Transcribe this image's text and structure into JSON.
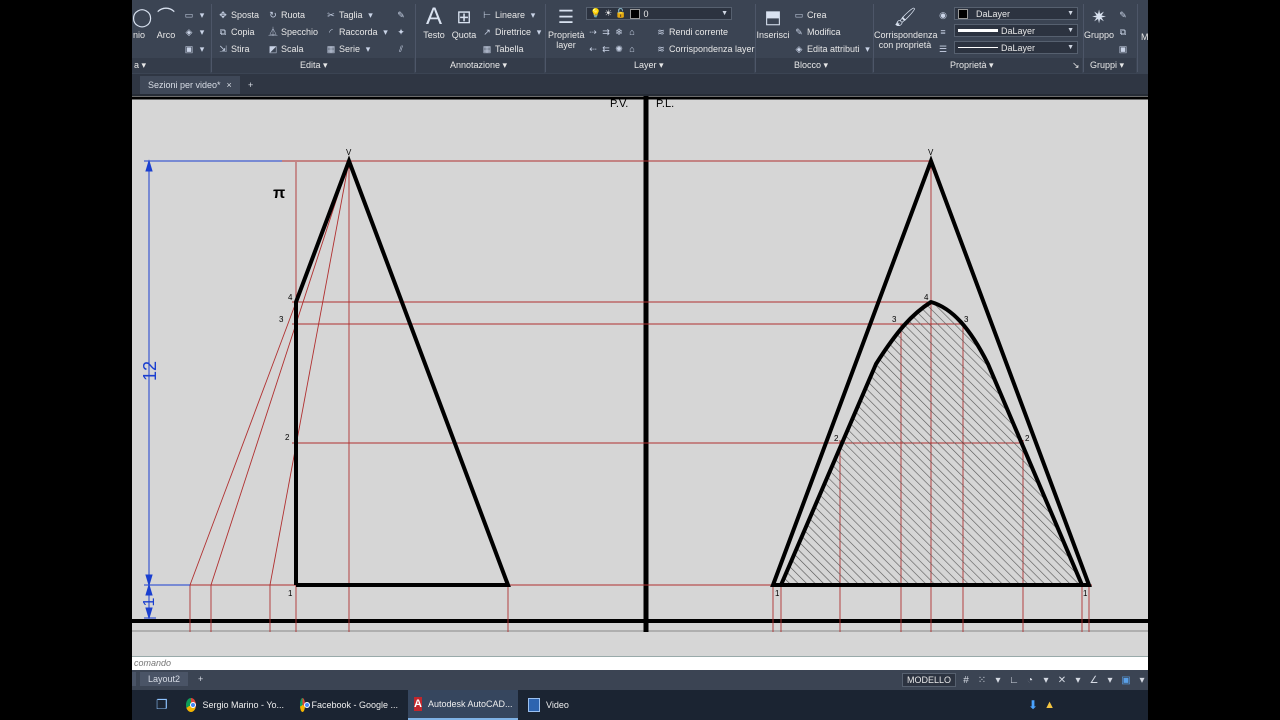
{
  "ribbon": {
    "partial_left_label": "nio",
    "arc_label": "Arco",
    "edit": {
      "title": "Edita",
      "items": [
        "Sposta",
        "Ruota",
        "Taglia",
        "Copia",
        "Specchio",
        "Raccorda",
        "Stira",
        "Scala",
        "Serie"
      ]
    },
    "annotation": {
      "title": "Annotazione",
      "text_label": "Testo",
      "dim_label": "Quota",
      "linear": "Lineare",
      "leader": "Direttrice",
      "table": "Tabella"
    },
    "layer": {
      "title": "Layer",
      "props_label": "Proprietà layer",
      "current_layer": "0",
      "make_current": "Rendi corrente",
      "match_layer": "Corrispondenza layer"
    },
    "block": {
      "title": "Blocco",
      "insert_label": "Inserisci",
      "create": "Crea",
      "edit": "Modifica",
      "edit_attributes": "Edita attributi"
    },
    "properties": {
      "title": "Proprietà",
      "match_label": "Corrispondenza con proprietà",
      "color_value": "DaLayer",
      "linetype_value": "DaLayer",
      "lineweight_value": "DaLayer"
    },
    "groups": {
      "title": "Gruppi",
      "group_label": "Gruppo"
    }
  },
  "file_tab": {
    "label": "Sezioni per video*",
    "close": "×",
    "add": "+"
  },
  "drawing": {
    "label_pv": "P.V.",
    "label_pl": "P.L.",
    "label_pi": "π",
    "vertex_left": "V",
    "vertex_right": "V",
    "left_points": [
      "4",
      "3",
      "2",
      "1"
    ],
    "right_points_left": [
      "3",
      "2",
      "1"
    ],
    "right_points_right": [
      "3",
      "2",
      "1"
    ],
    "right_top": "4",
    "dim_height": "12",
    "dim_base": "1"
  },
  "command_line": {
    "placeholder": "comando"
  },
  "layouts": {
    "tab": "Layout2",
    "add": "+"
  },
  "status": {
    "model_button": "MODELLO"
  },
  "taskbar": {
    "items": [
      {
        "label": "Sergio Marino - Yo..."
      },
      {
        "label": "Facebook - Google ..."
      },
      {
        "label": "Autodesk AutoCAD..."
      },
      {
        "label": "Video"
      }
    ]
  },
  "colors": {
    "ribbon_bg": "#3b4453",
    "canvas_bg": "#d6d6d6",
    "construction_red": "#b03030",
    "dimension_blue": "#1a3fd0"
  }
}
